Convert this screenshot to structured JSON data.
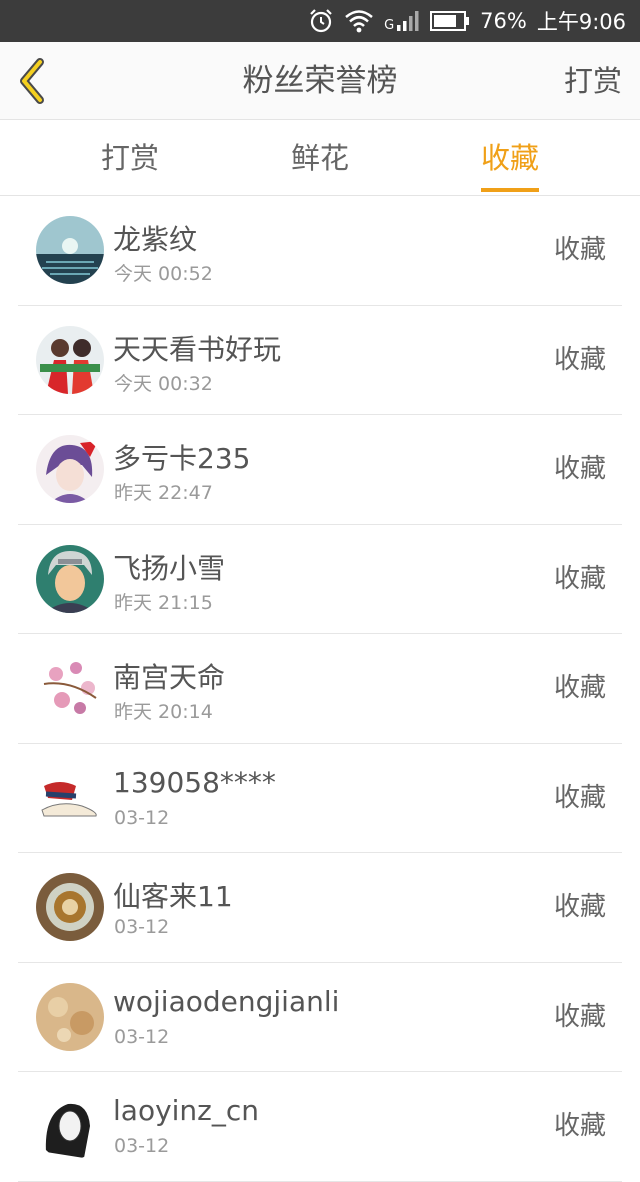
{
  "status_bar": {
    "network": "G",
    "battery": "76%",
    "time": "上午9:06"
  },
  "header": {
    "title": "粉丝荣誉榜",
    "right_action": "打赏",
    "back_icon": "chevron-left-icon"
  },
  "tabs": [
    {
      "label": "打赏",
      "active": false
    },
    {
      "label": "鲜花",
      "active": false
    },
    {
      "label": "收藏",
      "active": true
    }
  ],
  "colors": {
    "accent": "#f0a018",
    "status_bar_bg": "#3c3c3c",
    "text_primary": "#555555",
    "text_secondary": "#9a9a9a"
  },
  "fans": [
    {
      "name": "龙紫纹",
      "time": "今天 00:52",
      "action": "收藏"
    },
    {
      "name": "天天看书好玩",
      "time": "今天 00:32",
      "action": "收藏"
    },
    {
      "name": "多亏卡235",
      "time": "昨天 22:47",
      "action": "收藏"
    },
    {
      "name": "飞扬小雪",
      "time": "昨天 21:15",
      "action": "收藏"
    },
    {
      "name": "南宫天命",
      "time": "昨天 20:14",
      "action": "收藏"
    },
    {
      "name": "139058****",
      "time": "03-12",
      "action": "收藏"
    },
    {
      "name": "仙客来11",
      "time": "03-12",
      "action": "收藏"
    },
    {
      "name": "wojiaodengjianli",
      "time": "03-12",
      "action": "收藏"
    },
    {
      "name": "laoyinz_cn",
      "time": "03-12",
      "action": "收藏"
    }
  ]
}
